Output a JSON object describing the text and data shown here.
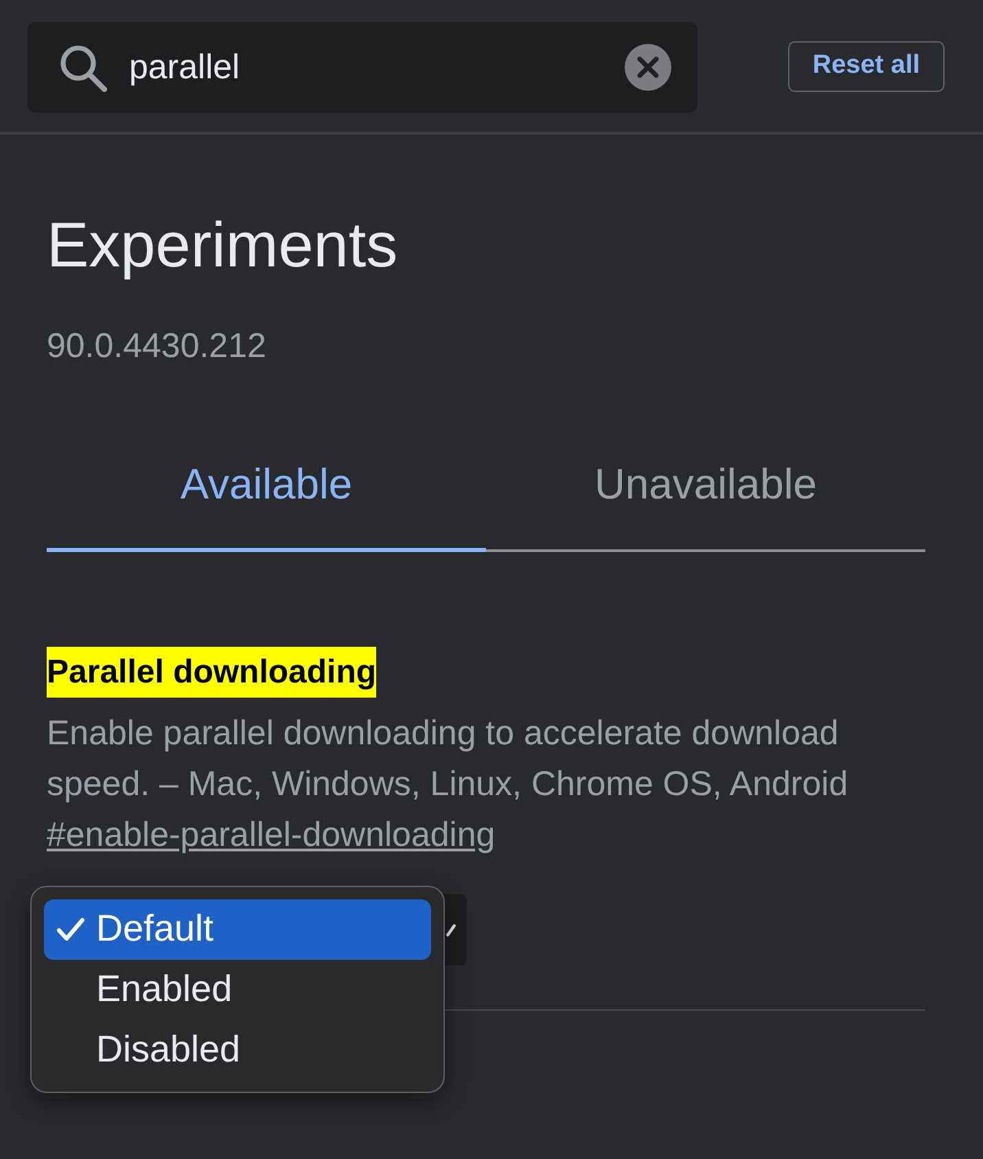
{
  "search": {
    "value": "parallel"
  },
  "reset_button": {
    "label": "Reset all"
  },
  "page": {
    "title": "Experiments",
    "version": "90.0.4430.212"
  },
  "tabs": [
    {
      "label": "Available",
      "selected": true
    },
    {
      "label": "Unavailable",
      "selected": false
    }
  ],
  "experiments": [
    {
      "title": "Parallel downloading",
      "highlighted": true,
      "description": "Enable parallel downloading to accelerate download speed. – Mac, Windows, Linux, Chrome OS, Android",
      "link": "#enable-parallel-downloading",
      "dropdown": {
        "open": true,
        "options": [
          {
            "label": "Default",
            "selected": true
          },
          {
            "label": "Enabled",
            "selected": false
          },
          {
            "label": "Disabled",
            "selected": false
          }
        ]
      }
    }
  ]
}
